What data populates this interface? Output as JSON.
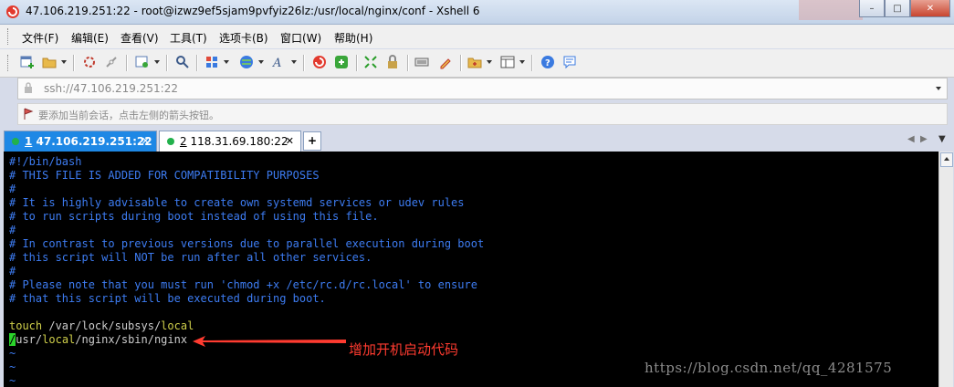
{
  "window": {
    "title": "47.106.219.251:22 - root@izwz9ef5sjam9pvfyiz26lz:/usr/local/nginx/conf - Xshell 6",
    "controls": [
      "–",
      "□",
      "✕"
    ]
  },
  "menu": [
    "文件(F)",
    "编辑(E)",
    "查看(V)",
    "工具(T)",
    "选项卡(B)",
    "窗口(W)",
    "帮助(H)"
  ],
  "toolbar": {
    "icons": [
      "new-session-icon",
      "open-folder-icon",
      "reconnect-icon",
      "disconnect-icon",
      "properties-icon",
      "find-icon",
      "layout-icon",
      "globe-icon",
      "font-icon",
      "xshell-icon",
      "xftp-icon",
      "fullscreen-icon",
      "lock-icon",
      "keyboard-icon",
      "highlight-icon",
      "new-folder-icon",
      "window-layout-icon",
      "help-icon",
      "chat-icon"
    ]
  },
  "address": {
    "value": "ssh://47.106.219.251:22"
  },
  "quickbar": {
    "hint": "要添加当前会话，点击左侧的箭头按钮。"
  },
  "tabs": [
    {
      "number": "1",
      "label": "47.106.219.251:22",
      "active": true,
      "status": "connected"
    },
    {
      "number": "2",
      "label": "118.31.69.180:22",
      "active": false,
      "status": "connected"
    }
  ],
  "terminal": {
    "lines": [
      {
        "type": "comment",
        "text": "#!/bin/bash"
      },
      {
        "type": "comment",
        "text": "# THIS FILE IS ADDED FOR COMPATIBILITY PURPOSES"
      },
      {
        "type": "comment",
        "text": "#"
      },
      {
        "type": "comment",
        "text": "# It is highly advisable to create own systemd services or udev rules"
      },
      {
        "type": "comment",
        "text": "# to run scripts during boot instead of using this file."
      },
      {
        "type": "comment",
        "text": "#"
      },
      {
        "type": "comment",
        "text": "# In contrast to previous versions due to parallel execution during boot"
      },
      {
        "type": "comment",
        "text": "# this script will NOT be run after all other services."
      },
      {
        "type": "comment",
        "text": "#"
      },
      {
        "type": "comment",
        "text": "# Please note that you must run 'chmod +x /etc/rc.d/rc.local' to ensure"
      },
      {
        "type": "comment",
        "text": "# that this script will be executed during boot."
      },
      {
        "type": "blank",
        "text": ""
      }
    ],
    "touch_line": {
      "cmd": "touch",
      "path1": " /var/lock/subsys/",
      "path2": "local"
    },
    "nginx_line": {
      "cursor": "/",
      "p1": "usr/",
      "p2": "local",
      "p3": "/nginx/sbin/nginx"
    },
    "tildes": [
      "~",
      "~",
      "~"
    ],
    "annotation": "增加开机启动代码",
    "watermark": "https://blog.csdn.net/qq_4281575"
  },
  "colors": {
    "active_tab": "#1e88e5",
    "comment": "#3d7cf2",
    "keyword": "#cfcf4a",
    "cursor": "#2bd42b",
    "annotation": "#ff3b30"
  }
}
